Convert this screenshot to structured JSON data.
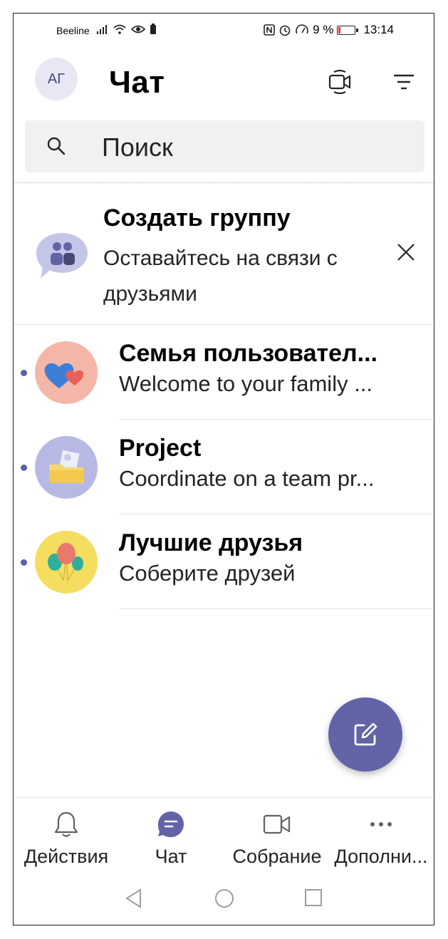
{
  "status_bar": {
    "carrier": "Beeline",
    "battery_percent": "9 %",
    "time": "13:14"
  },
  "header": {
    "avatar_initials": "АГ",
    "title": "Чат"
  },
  "search": {
    "placeholder": "Поиск"
  },
  "banner": {
    "title": "Создать группу",
    "subtitle": "Оставайтесь на связи с друзьями"
  },
  "chats": [
    {
      "name": "Семья пользовател...",
      "preview": "Welcome to your family ...",
      "unread": true
    },
    {
      "name": "Project",
      "preview": "Coordinate on a team pr...",
      "unread": true
    },
    {
      "name": "Лучшие друзья",
      "preview": "Соберите друзей",
      "unread": true
    }
  ],
  "bottom_nav": {
    "items": [
      {
        "label": "Действия",
        "icon": "bell-icon",
        "active": false
      },
      {
        "label": "Чат",
        "icon": "chat-icon",
        "active": true
      },
      {
        "label": "Собрание",
        "icon": "video-camera-icon",
        "active": false
      },
      {
        "label": "Дополни...",
        "icon": "more-icon",
        "active": false
      }
    ]
  },
  "colors": {
    "accent": "#6264a7",
    "unread_dot": "#5b5fa7",
    "avatar_bg": "#e8e8f4",
    "search_bg": "#f1f1f1"
  }
}
